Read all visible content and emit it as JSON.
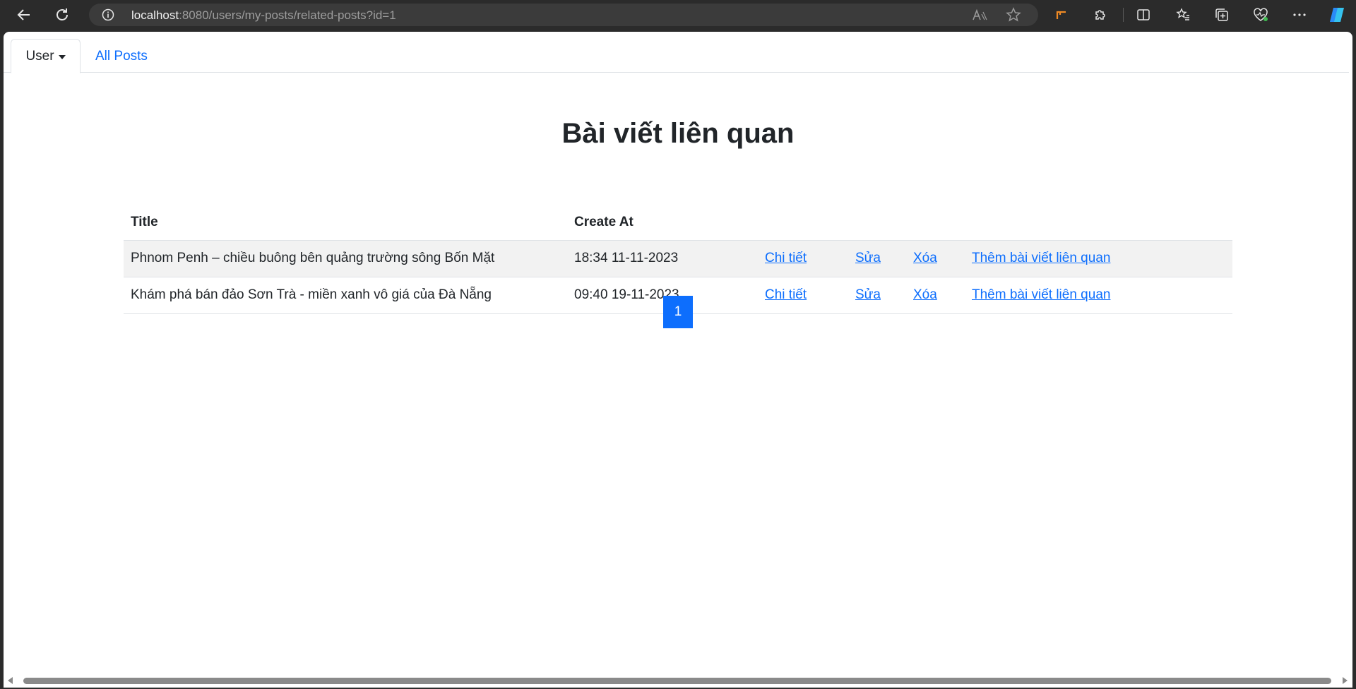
{
  "browser": {
    "url_host": "localhost",
    "url_rest": ":8080/users/my-posts/related-posts?id=1"
  },
  "nav": {
    "user_tab": "User",
    "all_posts_tab": "All Posts"
  },
  "page": {
    "heading": "Bài viết liên quan"
  },
  "table": {
    "columns": [
      "Title",
      "Create At"
    ],
    "rows": [
      {
        "title": "Phnom Penh – chiều buông bên quảng trường sông Bốn Mặt",
        "created_at": "18:34 11-11-2023",
        "detail": "Chi tiết",
        "edit": "Sửa",
        "delete": "Xóa",
        "add_related": "Thêm bài viết liên quan"
      },
      {
        "title": "Khám phá bán đảo Sơn Trà - miền xanh vô giá của Đà Nẵng",
        "created_at": "09:40 19-11-2023",
        "detail": "Chi tiết",
        "edit": "Sửa",
        "delete": "Xóa",
        "add_related": "Thêm bài viết liên quan"
      }
    ]
  },
  "pagination": {
    "current_page": "1"
  },
  "colors": {
    "primary": "#0d6efd",
    "stripe": "#f2f2f2",
    "browser_chrome": "#2b2b2b"
  }
}
